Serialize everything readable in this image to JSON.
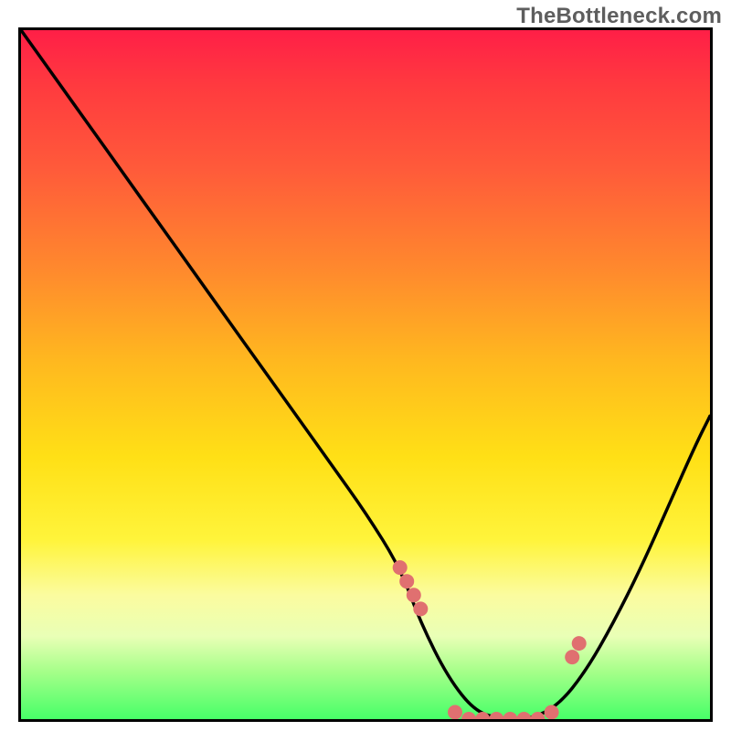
{
  "watermark": "TheBottleneck.com",
  "chart_data": {
    "type": "line",
    "title": "",
    "xlabel": "",
    "ylabel": "",
    "note": "Bottleneck-style V-curve heatmap. x and y are normalized 0–100 (no visible axis ticks or labels in source).",
    "x": [
      0,
      5,
      10,
      15,
      20,
      25,
      30,
      35,
      40,
      45,
      50,
      55,
      58,
      62,
      66,
      70,
      74,
      78,
      82,
      86,
      90,
      94,
      98,
      100
    ],
    "y": [
      100,
      93,
      86,
      79,
      72,
      65,
      58,
      51,
      44,
      37,
      30,
      22,
      14,
      6,
      1,
      0,
      0,
      2,
      7,
      14,
      22,
      31,
      40,
      44
    ],
    "series": [
      {
        "name": "bottleneck-curve",
        "x": [
          0,
          5,
          10,
          15,
          20,
          25,
          30,
          35,
          40,
          45,
          50,
          55,
          58,
          62,
          66,
          70,
          74,
          78,
          82,
          86,
          90,
          94,
          98,
          100
        ],
        "y": [
          100,
          93,
          86,
          79,
          72,
          65,
          58,
          51,
          44,
          37,
          30,
          22,
          14,
          6,
          1,
          0,
          0,
          2,
          7,
          14,
          22,
          31,
          40,
          44
        ]
      },
      {
        "name": "highlight-dots",
        "x": [
          55,
          56,
          57,
          58,
          63,
          65,
          67,
          69,
          71,
          73,
          75,
          77,
          80,
          81
        ],
        "y": [
          22,
          20,
          18,
          16,
          1,
          0,
          0,
          0,
          0,
          0,
          0,
          1,
          9,
          11
        ]
      }
    ],
    "xlim": [
      0,
      100
    ],
    "ylim": [
      0,
      100
    ]
  }
}
